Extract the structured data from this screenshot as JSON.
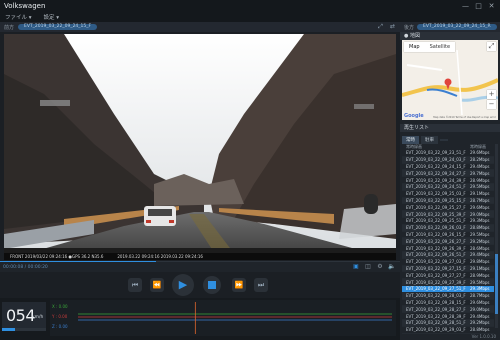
{
  "window": {
    "title": "Volkswagen",
    "controls": [
      "—",
      "□",
      "✕"
    ]
  },
  "menu": [
    {
      "label": "ファイル ▾"
    },
    {
      "label": "設定 ▾"
    }
  ],
  "infobar": {
    "label": "前方",
    "file": "EVT_2019_03_22_09_24_15_F"
  },
  "rinfobar": {
    "label": "後方",
    "file": "EVT_2019_03_22_09_24_15_R"
  },
  "osd": {
    "left": "FRONT 2019/03/22 09:24:16  ●GPS 36.2  N35.6",
    "right": "2019.03.22 09:24:16  2019.03.22 09:24:16"
  },
  "timebar": {
    "time": "00:00:08 / 00:00:20",
    "progress_fraction": 0.39
  },
  "speed": {
    "value": "054",
    "unit": "km/h",
    "level_fraction": 0.3
  },
  "gsensor": {
    "labels": [
      {
        "text": "X : 0.00",
        "color": "#3aa63a"
      },
      {
        "text": "Y : 0.00",
        "color": "#cc3b3b"
      },
      {
        "text": "Z : 0.00",
        "color": "#3b7fd0"
      }
    ],
    "cursor_fraction": 0.42
  },
  "right_panel": {
    "map_title": "● 地図",
    "map": {
      "tab_map": "Map",
      "tab_satellite": "Satellite",
      "zoom_in": "+",
      "zoom_out": "−",
      "logo": "Google",
      "footer": "Map data ©2019   Terms of Use   Report a map error"
    },
    "list_title": "再生リスト",
    "list_tabs": [
      {
        "label": "常時"
      },
      {
        "label": "駐車"
      },
      {
        "label": ""
      }
    ],
    "columns": {
      "name": "常時録画",
      "size": "常時録画"
    },
    "files": [
      {
        "name": "EVT_2019_03_22_09_23_51_F",
        "size": "29.6Mbps",
        "selected": false
      },
      {
        "name": "EVT_2019_03_22_09_24_03_F",
        "size": "28.2Mbps",
        "selected": false
      },
      {
        "name": "EVT_2019_03_22_09_24_15_F",
        "size": "29.4Mbps",
        "selected": false
      },
      {
        "name": "EVT_2019_03_22_09_24_27_F",
        "size": "29.7Mbps",
        "selected": false
      },
      {
        "name": "EVT_2019_03_22_09_24_39_F",
        "size": "28.9Mbps",
        "selected": false
      },
      {
        "name": "EVT_2019_03_22_09_24_51_F",
        "size": "29.5Mbps",
        "selected": false
      },
      {
        "name": "EVT_2019_03_22_09_25_03_F",
        "size": "29.1Mbps",
        "selected": false
      },
      {
        "name": "EVT_2019_03_22_09_25_15_F",
        "size": "28.7Mbps",
        "selected": false
      },
      {
        "name": "EVT_2019_03_22_09_25_27_F",
        "size": "29.6Mbps",
        "selected": false
      },
      {
        "name": "EVT_2019_03_22_09_25_39_F",
        "size": "29.0Mbps",
        "selected": false
      },
      {
        "name": "EVT_2019_03_22_09_25_51_F",
        "size": "29.3Mbps",
        "selected": false
      },
      {
        "name": "EVT_2019_03_22_09_26_03_F",
        "size": "28.8Mbps",
        "selected": false
      },
      {
        "name": "EVT_2019_03_22_09_26_15_F",
        "size": "29.5Mbps",
        "selected": false
      },
      {
        "name": "EVT_2019_03_22_09_26_27_F",
        "size": "29.2Mbps",
        "selected": false
      },
      {
        "name": "EVT_2019_03_22_09_26_39_F",
        "size": "28.6Mbps",
        "selected": false
      },
      {
        "name": "EVT_2019_03_22_09_26_51_F",
        "size": "29.4Mbps",
        "selected": false
      },
      {
        "name": "EVT_2019_03_22_09_27_03_F",
        "size": "29.8Mbps",
        "selected": false
      },
      {
        "name": "EVT_2019_03_22_09_27_15_F",
        "size": "29.1Mbps",
        "selected": false
      },
      {
        "name": "EVT_2019_03_22_09_27_27_F",
        "size": "28.9Mbps",
        "selected": false
      },
      {
        "name": "EVT_2019_03_22_09_27_39_F",
        "size": "29.5Mbps",
        "selected": false
      },
      {
        "name": "EVT_2019_03_22_09_27_51_F",
        "size": "29.3Mbps",
        "selected": true
      },
      {
        "name": "EVT_2019_03_22_09_28_03_F",
        "size": "28.7Mbps",
        "selected": false
      },
      {
        "name": "EVT_2019_03_22_09_28_15_F",
        "size": "29.6Mbps",
        "selected": false
      },
      {
        "name": "EVT_2019_03_22_09_28_27_F",
        "size": "29.0Mbps",
        "selected": false
      },
      {
        "name": "EVT_2019_03_22_09_28_39_F",
        "size": "29.4Mbps",
        "selected": false
      },
      {
        "name": "EVT_2019_03_22_09_28_51_F",
        "size": "29.2Mbps",
        "selected": false
      },
      {
        "name": "EVT_2019_03_22_09_29_03_F",
        "size": "28.8Mbps",
        "selected": false
      }
    ],
    "version": "Ver 1.0.0.10"
  },
  "colors": {
    "accent": "#2f8fe0",
    "bg": "#1b1f24"
  }
}
